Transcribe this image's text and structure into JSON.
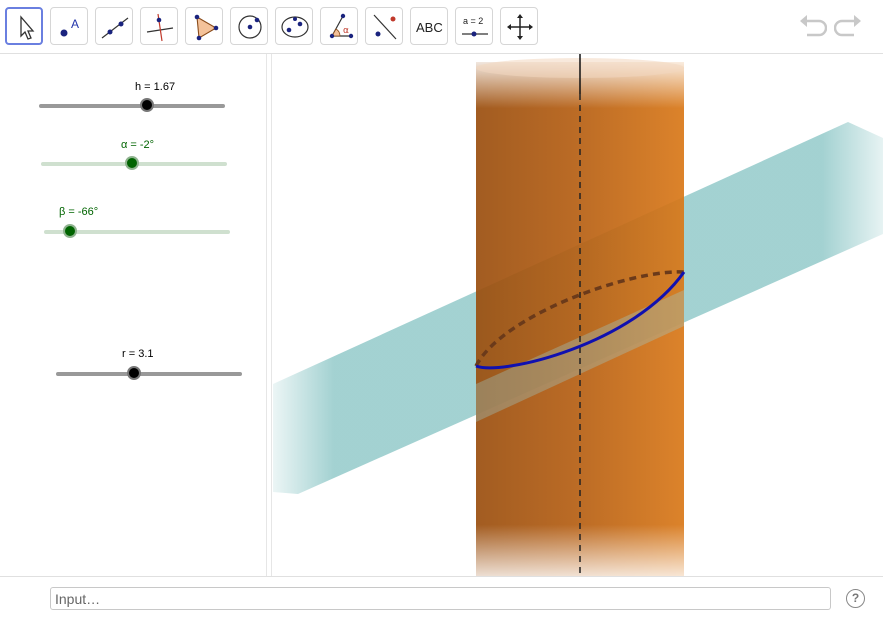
{
  "toolbar": {
    "tools": [
      {
        "icon": "move-arrow-icon"
      },
      {
        "icon": "point-icon",
        "glyph": "A"
      },
      {
        "icon": "line-icon"
      },
      {
        "icon": "perpendicular-line-icon"
      },
      {
        "icon": "polygon-icon"
      },
      {
        "icon": "circle-with-center-icon"
      },
      {
        "icon": "ellipse-icon"
      },
      {
        "icon": "angle-icon",
        "glyph": "α"
      },
      {
        "icon": "reflect-about-line-icon"
      },
      {
        "icon": "text-icon",
        "glyph": "ABC"
      },
      {
        "icon": "slider-icon",
        "glyph": "a = 2"
      },
      {
        "icon": "move-graphics-view-icon"
      }
    ],
    "undo_icon": "undo-icon",
    "redo_icon": "redo-icon"
  },
  "sliders": {
    "h": {
      "label": "h = 1.67",
      "value_fraction": 0.58,
      "color": "#000000",
      "track": "#999999"
    },
    "alpha": {
      "label": "α = -2°",
      "value_fraction": 0.49,
      "color": "#006400",
      "track": "#cfe0cf"
    },
    "beta": {
      "label": "β = -66°",
      "value_fraction": 0.14,
      "color": "#006400",
      "track": "#cfe0cf"
    },
    "r": {
      "label": "r = 3.1",
      "value_fraction": 0.42,
      "color": "#000000",
      "track": "#999999"
    }
  },
  "graphics": {
    "cylinder_color": "#cc6a14",
    "plane_color": "#9ecfcf",
    "ellipse_color": "#1010b0"
  },
  "input": {
    "placeholder": "Input…"
  },
  "help": {
    "icon": "help-icon",
    "glyph": "?"
  }
}
